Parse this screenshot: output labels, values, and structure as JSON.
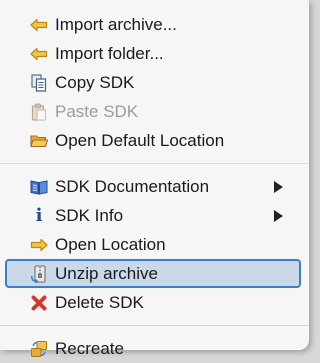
{
  "menu": {
    "items": [
      {
        "label": "Import archive...",
        "icon": "import-arrow-icon"
      },
      {
        "label": "Import folder...",
        "icon": "import-arrow-icon"
      },
      {
        "label": "Copy SDK",
        "icon": "copy-icon"
      },
      {
        "label": "Paste SDK",
        "icon": "paste-icon",
        "disabled": true
      },
      {
        "label": "Open Default Location",
        "icon": "folder-icon"
      },
      {
        "label": "SDK Documentation",
        "icon": "book-icon",
        "submenu": true
      },
      {
        "label": "SDK Info",
        "icon": "info-icon",
        "submenu": true
      },
      {
        "label": "Open Location",
        "icon": "location-arrow-icon"
      },
      {
        "label": "Unzip archive",
        "icon": "unzip-icon",
        "highlighted": true
      },
      {
        "label": "Delete SDK",
        "icon": "delete-x-icon"
      },
      {
        "label": "Recreate",
        "icon": "recreate-icon"
      }
    ]
  },
  "colors": {
    "highlight_bg": "#c9d9ea",
    "highlight_border": "#3d7fc4",
    "disabled_text": "#9c9c9c",
    "delete_red": "#d9352b"
  }
}
